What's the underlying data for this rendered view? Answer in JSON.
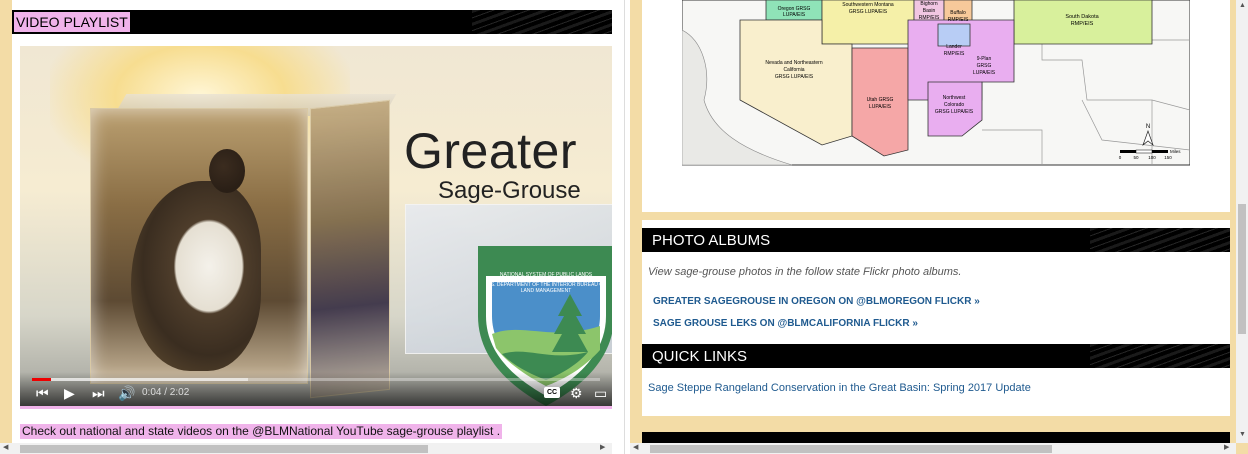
{
  "left": {
    "header_title": "VIDEO PLAYLIST",
    "video": {
      "title_main": "Greater",
      "title_sub": "Sage-Grouse",
      "logo_top_text": "NATIONAL SYSTEM OF PUBLIC LANDS",
      "logo_text": "U.S. DEPARTMENT OF THE INTERIOR BUREAU OF LAND MANAGEMENT",
      "time": "0:04 / 2:02",
      "progress_played_fraction": 0.033,
      "progress_buffered_fraction": 0.38,
      "cc_label": "CC"
    },
    "caption": "Check out national and state videos on the @BLMNational YouTube sage-grouse playlist ."
  },
  "right": {
    "map": {
      "regions": {
        "oregon": [
          "Oregon GRSG",
          "LUPA/EIS"
        ],
        "montana": [
          "Southwestern Montana",
          "GRSG LUPA/EIS"
        ],
        "basin": [
          "Bighorn",
          "Basin",
          "RMP/EIS"
        ],
        "buffalo": [
          "Buffalo",
          "RMP/EIS"
        ],
        "south_dakota": [
          "South Dakota",
          "RMP/EIS"
        ],
        "nevada": [
          "Nevada and Northeastern",
          "California",
          "GRSG LUPA/EIS"
        ],
        "lander": [
          "Lander",
          "RMP/EIS"
        ],
        "nine_plan": [
          "9-Plan",
          "GRSG",
          "LUPA/EIS"
        ],
        "utah": [
          "Utah GRSG",
          "LUPA/EIS"
        ],
        "colorado": [
          "Northwest",
          "Colorado",
          "GRSG LUPA/EIS"
        ]
      },
      "north_label": "N",
      "scale_unit": "Miles",
      "scale_ticks": [
        "0",
        "50",
        "100",
        "150"
      ]
    },
    "photo_albums": {
      "title": "PHOTO ALBUMS",
      "intro": "View sage-grouse photos in the follow state Flickr photo albums.",
      "links": [
        "GREATER SAGEGROUSE IN OREGON ON @BLMOREGON FLICKR  »",
        "SAGE GROUSE LEKS ON @BLMCALIFORNIA FLICKR  »"
      ]
    },
    "quick_links": {
      "title": "QUICK LINKS",
      "links": [
        "Sage Steppe Rangeland Conservation in the Great Basin: Spring 2017 Update"
      ]
    }
  },
  "colors": {
    "page_background": "#f3dca6",
    "highlight": "#f0b3ea",
    "link": "#1f5a8f",
    "progress": "#ee0000"
  }
}
